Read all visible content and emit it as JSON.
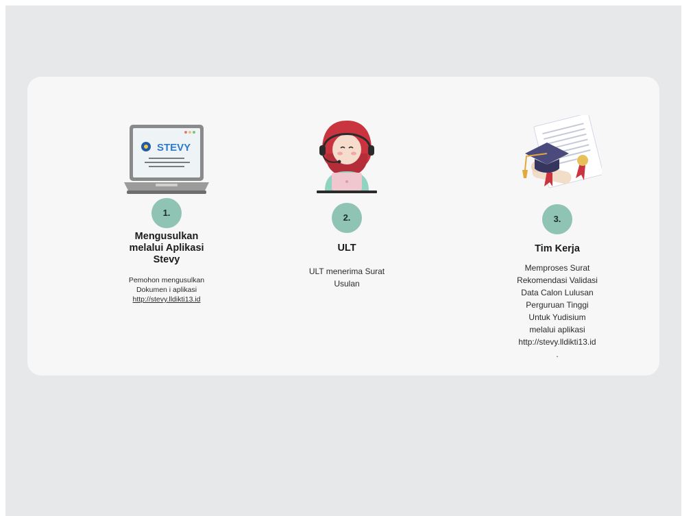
{
  "steps": [
    {
      "number": "1.",
      "title_lines": [
        "Mengusulkan",
        "melalui Aplikasi",
        "Stevy"
      ],
      "desc_lines": [
        "Pemohon mengusulkan",
        "Dokumen i aplikasi"
      ],
      "link": "http://stevy.lldikti13.id",
      "illustration": "laptop-stevy-icon",
      "logo_text": "STEVY"
    },
    {
      "number": "2.",
      "title": "ULT",
      "desc_lines": [
        "ULT menerima Surat",
        "Usulan"
      ],
      "illustration": "operator-headset-icon"
    },
    {
      "number": "3.",
      "title": "Tim Kerja",
      "desc_lines": [
        "Memproses Surat",
        "Rekomendasi Validasi",
        "Data Calon Lulusan",
        "Perguruan Tinggi",
        "Untuk Yudisium",
        "melalui aplikasi",
        "http://stevy.lldikti13.id",
        "."
      ],
      "illustration": "graduation-diploma-icon"
    }
  ],
  "colors": {
    "background": "#e7e8ea",
    "card": "#f7f7f7",
    "number_circle": "#8fc3b4"
  }
}
